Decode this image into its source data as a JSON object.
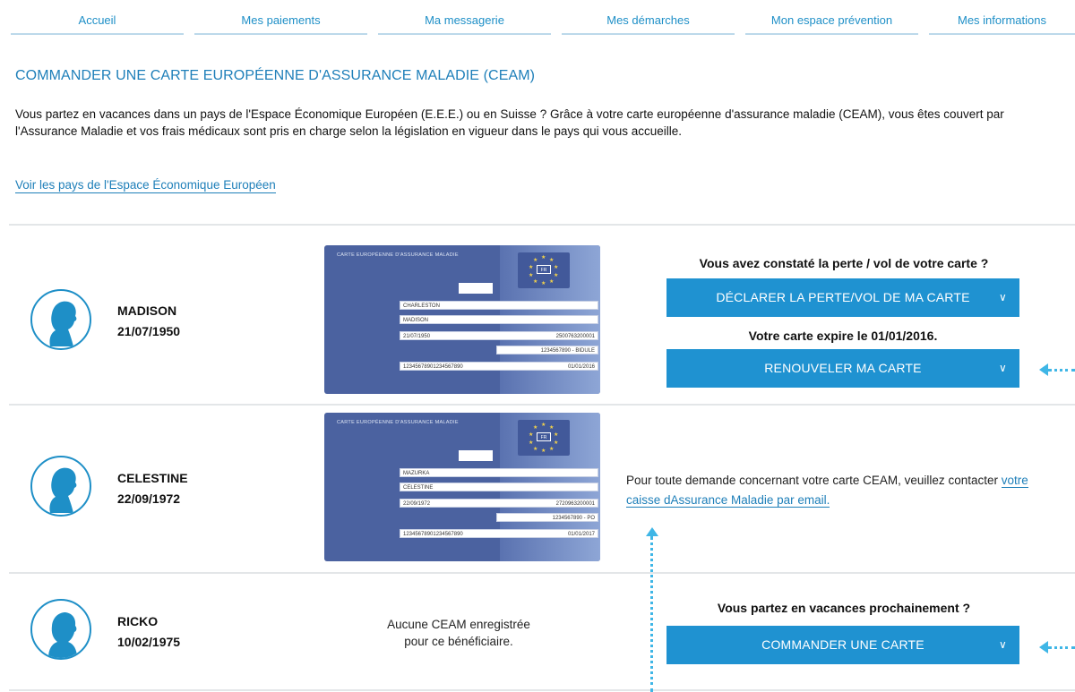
{
  "nav": {
    "items": [
      {
        "label": "Accueil"
      },
      {
        "label": "Mes paiements"
      },
      {
        "label": "Ma messagerie"
      },
      {
        "label": "Mes démarches"
      },
      {
        "label": "Mon espace prévention"
      },
      {
        "label": "Mes informations"
      }
    ]
  },
  "page": {
    "title": "COMMANDER UNE CARTE EUROPÉENNE D'ASSURANCE MALADIE (CEAM)",
    "intro": "Vous partez en vacances dans un pays de l'Espace Économique Européen (E.E.E.) ou en Suisse ? Grâce à votre carte européenne d'assurance maladie (CEAM), vous êtes couvert par l'Assurance Maladie et vos frais médicaux sont pris en charge selon la législation en vigueur dans le pays qui vous accueille.",
    "eee_link": "Voir les pays de l'Espace Économique Européen"
  },
  "card_common": {
    "title": "CARTE EUROPÉENNE D'ASSURANCE MALADIE",
    "flag_code": "FR"
  },
  "beneficiaries": [
    {
      "name": "MADISON",
      "dob": "21/07/1950",
      "card": {
        "surname": "CHARLESTON",
        "firstname": "MADISON",
        "birth": "21/07/1950",
        "number": "2500763200001",
        "institution": "1234567890 - BIDULE",
        "card_id": "12345678901234567890",
        "expiry": "01/01/2016"
      },
      "question": "Vous avez constaté la perte / vol de votre carte ?",
      "declare_button": "DÉCLARER LA PERTE/VOL DE MA CARTE",
      "expire_text": "Votre carte expire le 01/01/2016.",
      "renew_button": "RENOUVELER MA CARTE"
    },
    {
      "name": "CELESTINE",
      "dob": "22/09/1972",
      "card": {
        "surname": "MAZURKA",
        "firstname": "CELESTINE",
        "birth": "22/09/1972",
        "number": "2720963200001",
        "institution": "1234567890 - PO",
        "card_id": "12345678901234567890",
        "expiry": "01/01/2017"
      },
      "contact_prefix": "Pour toute demande concernant votre carte CEAM, veuillez contacter ",
      "contact_link": "votre caisse dAssurance Maladie par email."
    },
    {
      "name": "RICKO",
      "dob": "10/02/1975",
      "no_card_line1": "Aucune CEAM enregistrée",
      "no_card_line2": "pour ce bénéficiaire.",
      "question": "Vous partez en vacances prochainement ?",
      "order_button": "COMMANDER UNE CARTE"
    }
  ],
  "icons": {
    "chevron": "chevron-down-icon",
    "avatar_female": "female-profile-icon",
    "avatar_male": "male-profile-icon"
  },
  "colors": {
    "accent": "#1f92d1",
    "link": "#1e7fb9",
    "card": "#4b62a0",
    "annotation": "#3fb6e6"
  }
}
